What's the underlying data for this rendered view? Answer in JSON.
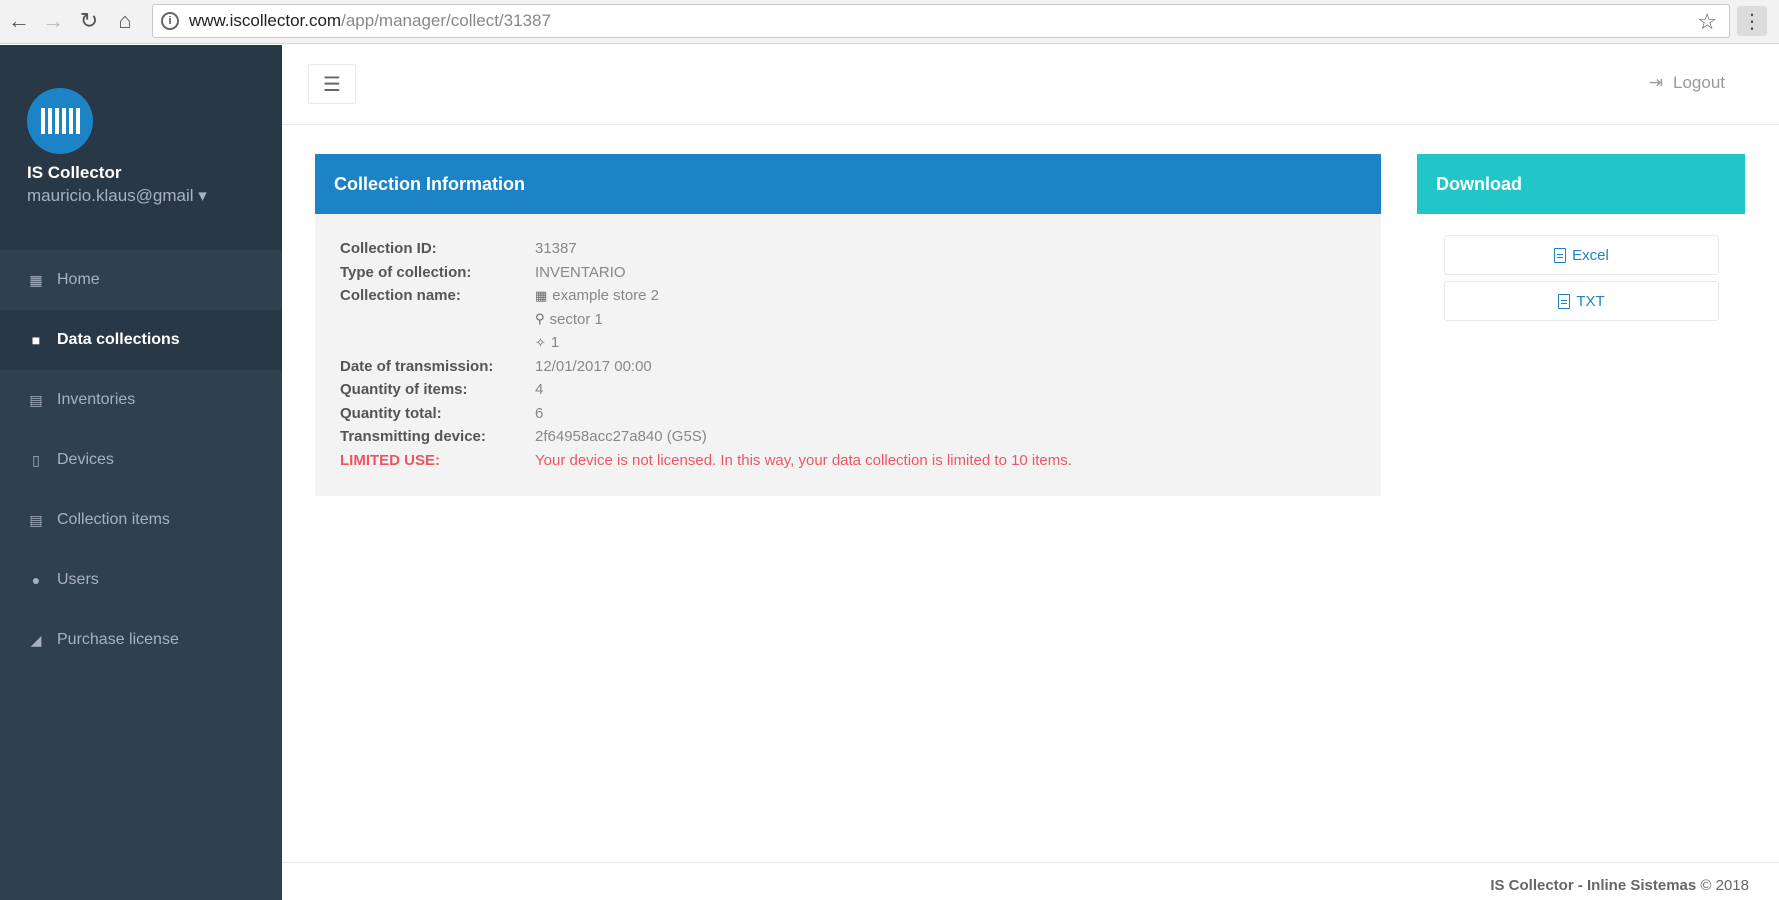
{
  "browser": {
    "url_host": "www.iscollector.com",
    "url_path": "/app/manager/collect/31387"
  },
  "sidebar": {
    "app_name": "IS Collector",
    "user_email": "mauricio.klaus@gmail ▾",
    "items": [
      {
        "label": "Home",
        "icon": "grid-icon"
      },
      {
        "label": "Data collections",
        "icon": "folder-icon"
      },
      {
        "label": "Inventories",
        "icon": "list-icon"
      },
      {
        "label": "Devices",
        "icon": "mobile-icon"
      },
      {
        "label": "Collection items",
        "icon": "list-icon"
      },
      {
        "label": "Users",
        "icon": "user-icon"
      },
      {
        "label": "Purchase license",
        "icon": "cart-icon"
      }
    ]
  },
  "topbar": {
    "logout_label": "Logout"
  },
  "collection": {
    "title": "Collection Information",
    "fields": {
      "id_label": "Collection ID:",
      "id_value": "31387",
      "type_label": "Type of collection:",
      "type_value": "INVENTARIO",
      "name_label": "Collection name:",
      "name_store": "example store 2",
      "name_sector": "sector 1",
      "name_count": "1",
      "date_label": "Date of transmission:",
      "date_value": "12/01/2017 00:00",
      "qty_items_label": "Quantity of items:",
      "qty_items_value": "4",
      "qty_total_label": "Quantity total:",
      "qty_total_value": "6",
      "device_label": "Transmitting device:",
      "device_value": "2f64958acc27a840 (G5S)",
      "limited_label": "LIMITED USE:",
      "limited_value": "Your device is not licensed. In this way, your data collection is limited to 10 items."
    }
  },
  "download": {
    "title": "Download",
    "excel_label": "Excel",
    "txt_label": "TXT"
  },
  "footer": {
    "brand": "IS Collector - Inline Sistemas",
    "copyright": "© 2018"
  },
  "colors": {
    "sidebar_bg": "#2f4050",
    "primary": "#1c84c6",
    "download_header": "#23c6c8",
    "warning": "#ed5565"
  }
}
